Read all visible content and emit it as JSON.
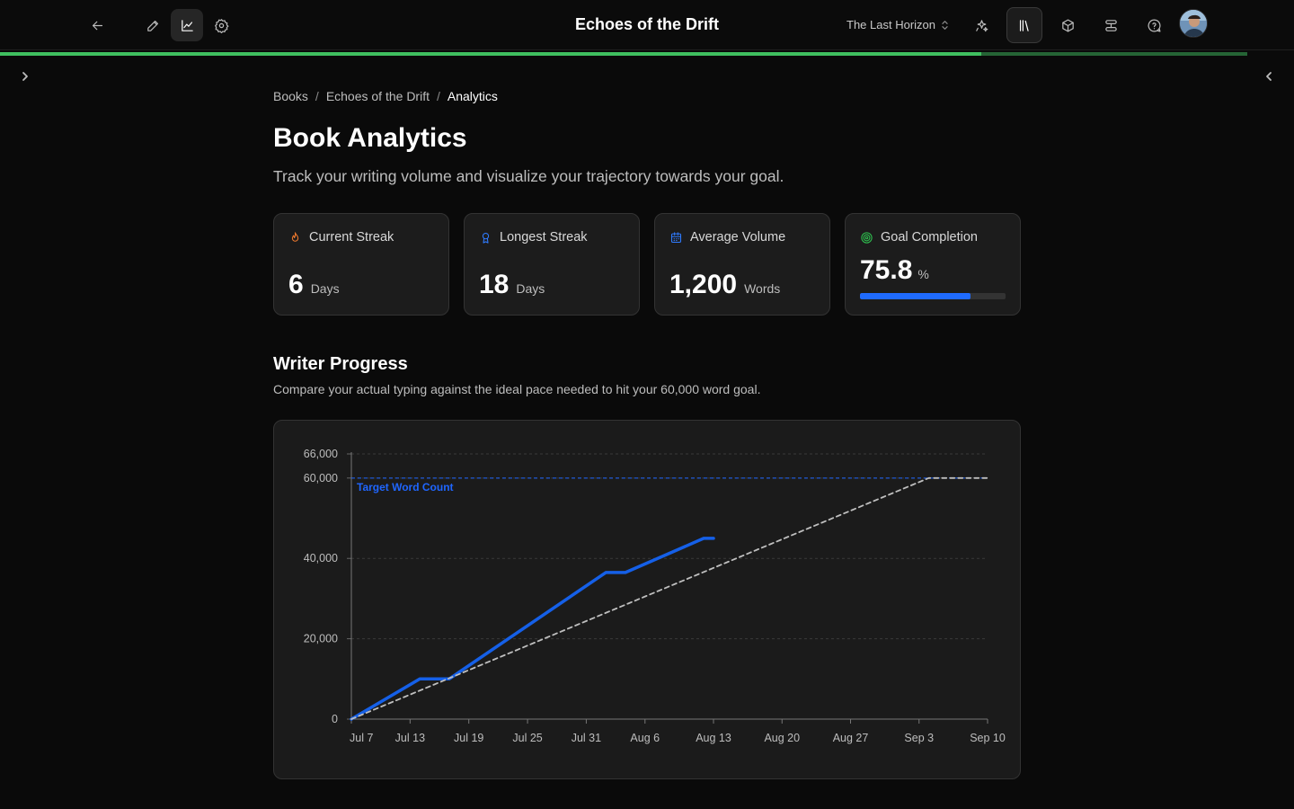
{
  "header": {
    "title": "Echoes of the Drift",
    "project_selector": "The Last Horizon",
    "icons": {
      "back": "arrow-left-icon",
      "edit": "pencil-icon",
      "analytics": "line-chart-icon",
      "settings": "gear-icon",
      "ai": "sparkles-icon",
      "library": "library-icon",
      "cube": "cube-icon",
      "workflow": "workflow-icon",
      "help": "help-circle-icon"
    },
    "colors": {
      "accent_progress": "#3fbf5f"
    }
  },
  "progress": {
    "fraction": 0.758
  },
  "breadcrumb": {
    "items": [
      "Books",
      "Echoes of the Drift"
    ],
    "separator": "/",
    "current": "Analytics"
  },
  "page": {
    "title": "Book Analytics",
    "subtitle": "Track your writing volume and visualize your trajectory towards your goal."
  },
  "stats": {
    "current_streak": {
      "label": "Current Streak",
      "value": "6",
      "unit": "Days",
      "icon": "flame-icon",
      "color": "#f07a2e"
    },
    "longest_streak": {
      "label": "Longest Streak",
      "value": "18",
      "unit": "Days",
      "icon": "award-icon",
      "color": "#2f7bff"
    },
    "average_volume": {
      "label": "Average Volume",
      "value": "1,200",
      "unit": "Words",
      "icon": "calendar-icon",
      "color": "#2f7bff"
    },
    "goal_completion": {
      "label": "Goal Completion",
      "value": "75.8",
      "unit": "%",
      "icon": "target-icon",
      "color": "#2fbf4f",
      "fraction": 0.758
    }
  },
  "writer_progress": {
    "title": "Writer Progress",
    "subtitle": "Compare your actual typing against the ideal pace needed to hit your 60,000 word goal."
  },
  "chart_data": {
    "type": "line",
    "x_tick_labels": [
      "Jul 7",
      "Jul 13",
      "Jul 19",
      "Jul 25",
      "Jul 31",
      "Aug 6",
      "Aug 13",
      "Aug 20",
      "Aug 27",
      "Sep 3",
      "Sep 10"
    ],
    "x_tick_dates": [
      "2024-07-07",
      "2024-07-13",
      "2024-07-19",
      "2024-07-25",
      "2024-07-31",
      "2024-08-06",
      "2024-08-13",
      "2024-08-20",
      "2024-08-27",
      "2024-09-03",
      "2024-09-10"
    ],
    "y_tick_labels": [
      "0",
      "20,000",
      "40,000",
      "60,000",
      "66,000"
    ],
    "y_tick_values": [
      0,
      20000,
      40000,
      60000,
      66000
    ],
    "ylim": [
      0,
      66000
    ],
    "xlim": [
      "2024-07-07",
      "2024-09-10"
    ],
    "grid": true,
    "series": [
      {
        "style": "solid",
        "color": "#1560e8",
        "points": [
          {
            "x": "2024-07-07",
            "y": 0
          },
          {
            "x": "2024-07-14",
            "y": 10000
          },
          {
            "x": "2024-07-17",
            "y": 10000
          },
          {
            "x": "2024-08-02",
            "y": 36500
          },
          {
            "x": "2024-08-04",
            "y": 36500
          },
          {
            "x": "2024-08-12",
            "y": 45000
          },
          {
            "x": "2024-08-13",
            "y": 45000
          }
        ]
      },
      {
        "style": "dashed",
        "color": "#bfbfbf",
        "points": [
          {
            "x": "2024-07-07",
            "y": 0
          },
          {
            "x": "2024-09-04",
            "y": 60000
          },
          {
            "x": "2024-09-10",
            "y": 60000
          }
        ]
      }
    ],
    "reference_lines": [
      {
        "y": 60000,
        "label": "Target Word Count",
        "color": "#1f66ff",
        "style": "dashed"
      }
    ]
  }
}
